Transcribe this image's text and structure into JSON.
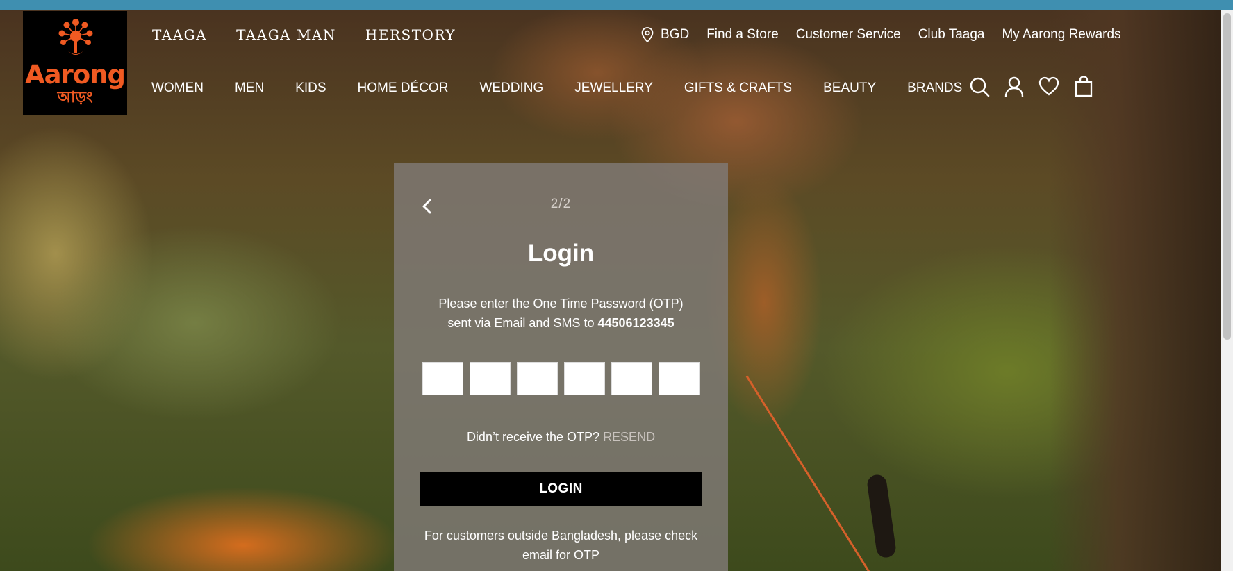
{
  "brand": {
    "logo_text": "Aarong",
    "logo_bangla": "আড়ং"
  },
  "brand_links": [
    "TAAGA",
    "TAAGA MAN",
    "HERSTORY"
  ],
  "util_links": {
    "country": "BGD",
    "find_store": "Find a Store",
    "customer_service": "Customer Service",
    "club_taaga": "Club Taaga",
    "rewards": "My Aarong Rewards"
  },
  "main_nav": [
    "WOMEN",
    "MEN",
    "KIDS",
    "HOME DÉCOR",
    "WEDDING",
    "JEWELLERY",
    "GIFTS & CRAFTS",
    "BEAUTY",
    "BRANDS"
  ],
  "icons": {
    "back": "chevron-left-icon",
    "search": "search-icon",
    "account": "user-icon",
    "wishlist": "heart-icon",
    "cart": "shopping-bag-icon",
    "location": "map-pin-icon"
  },
  "modal": {
    "step": "2/2",
    "title": "Login",
    "instruction_line1": "Please enter the One Time Password (OTP)",
    "instruction_line2_prefix": "sent via Email and SMS to",
    "phone": "44506123345",
    "otp_digits": [
      "",
      "",
      "",
      "",
      "",
      ""
    ],
    "resend_prompt": "Didn’t receive the OTP?",
    "resend_link": "RESEND",
    "login_button": "LOGIN",
    "note": "For customers outside Bangladesh, please check email for OTP"
  },
  "colors": {
    "brand_orange": "#f05a22",
    "top_strip": "#3f8fb0",
    "button_black": "#000000"
  }
}
